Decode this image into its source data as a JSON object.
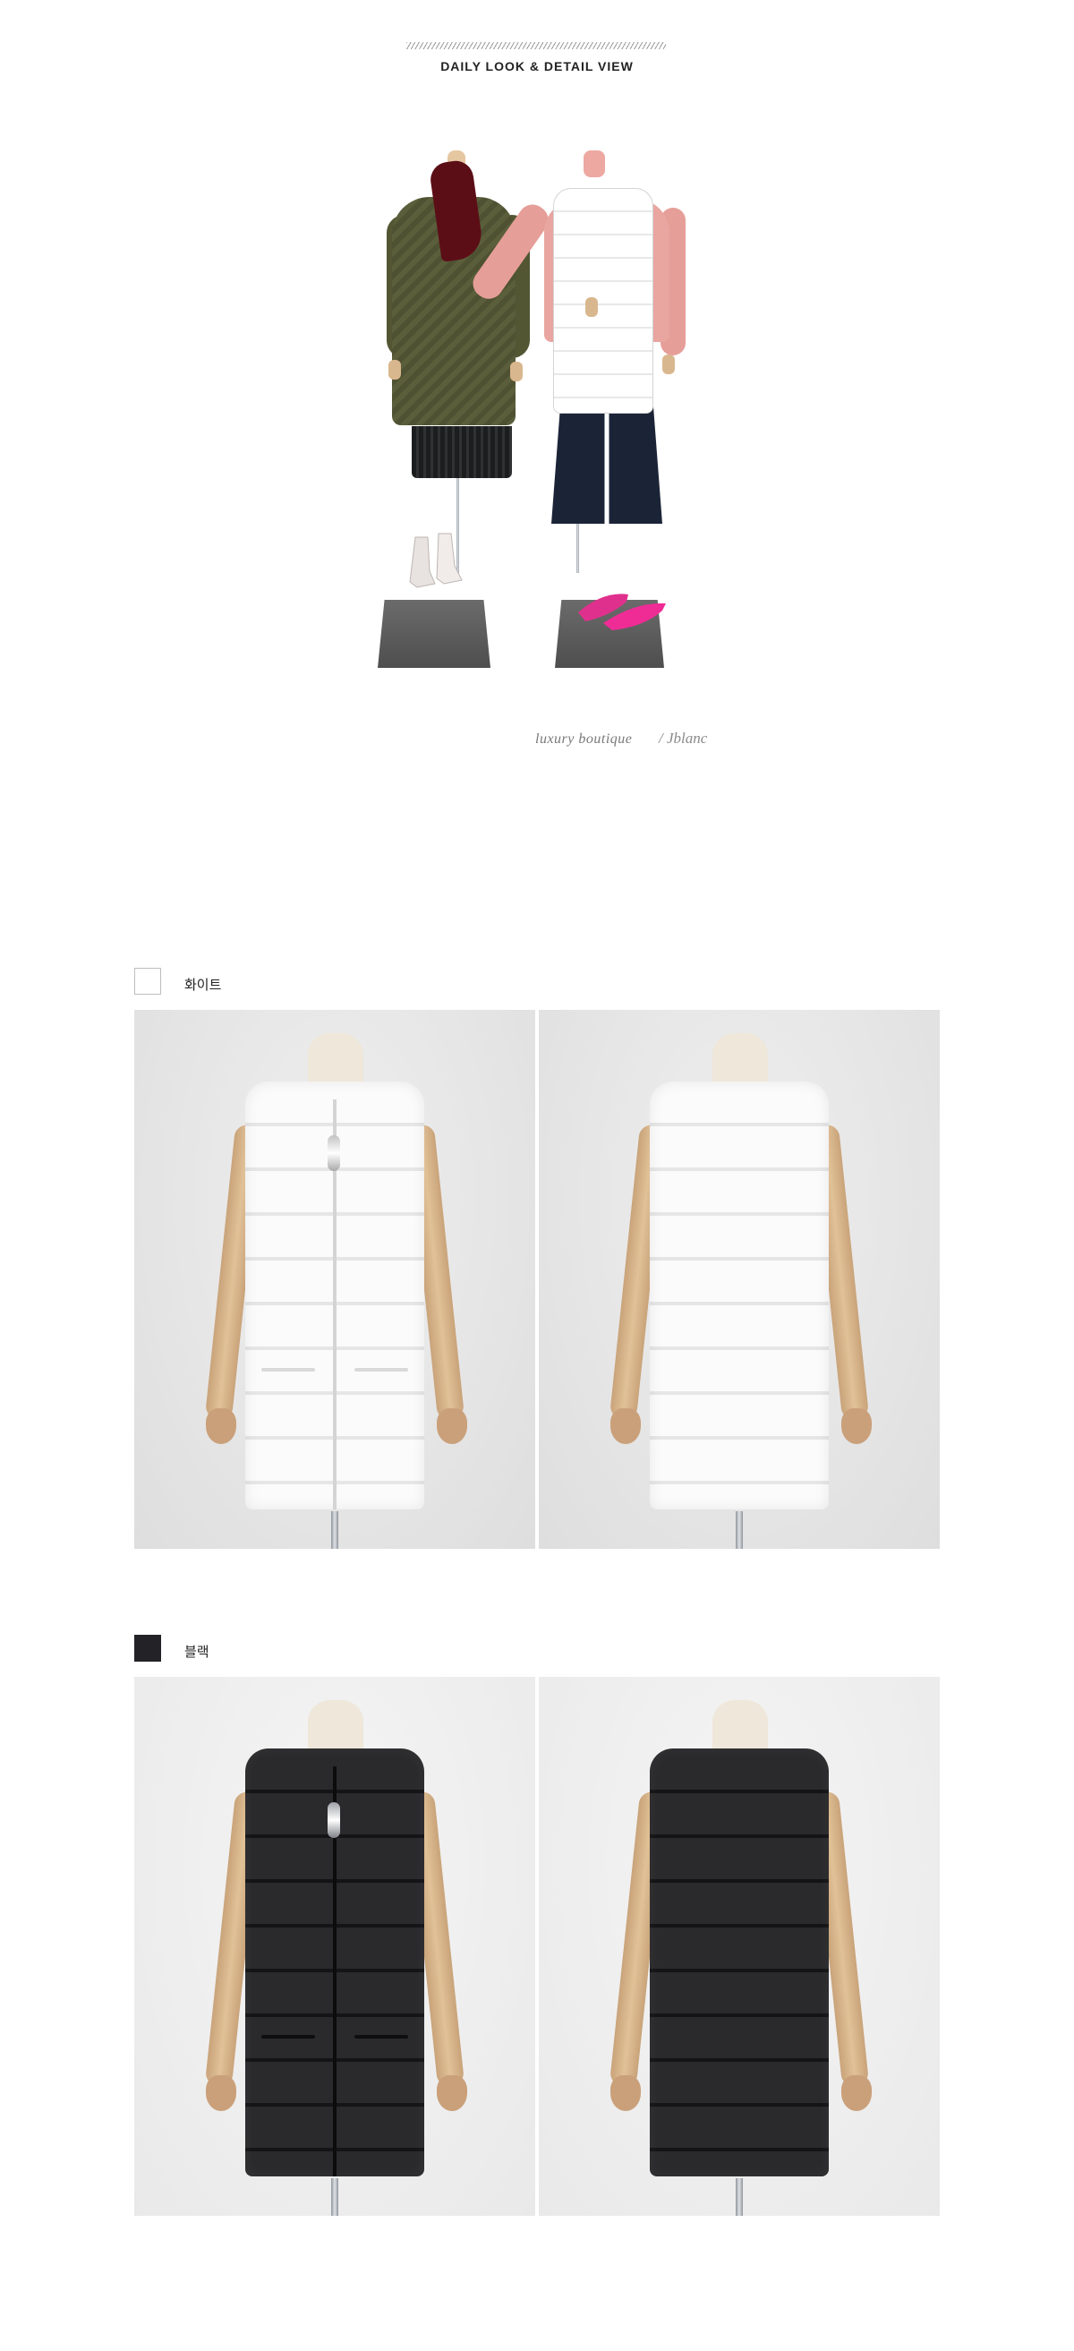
{
  "header": {
    "section_title": "DAILY LOOK & DETAIL VIEW"
  },
  "lookbook": {
    "brand_tagline": "luxury boutique",
    "brand_signature": "/ Jblanc"
  },
  "colors": [
    {
      "name": "화이트",
      "swatch_hex": "#ffffff",
      "photos": [
        "front-view",
        "back-view"
      ]
    },
    {
      "name": "블랙",
      "swatch_hex": "#222227",
      "photos": [
        "front-view",
        "back-view"
      ]
    }
  ],
  "icons": {
    "white_swatch": "white-color-swatch",
    "black_swatch": "black-color-swatch"
  }
}
